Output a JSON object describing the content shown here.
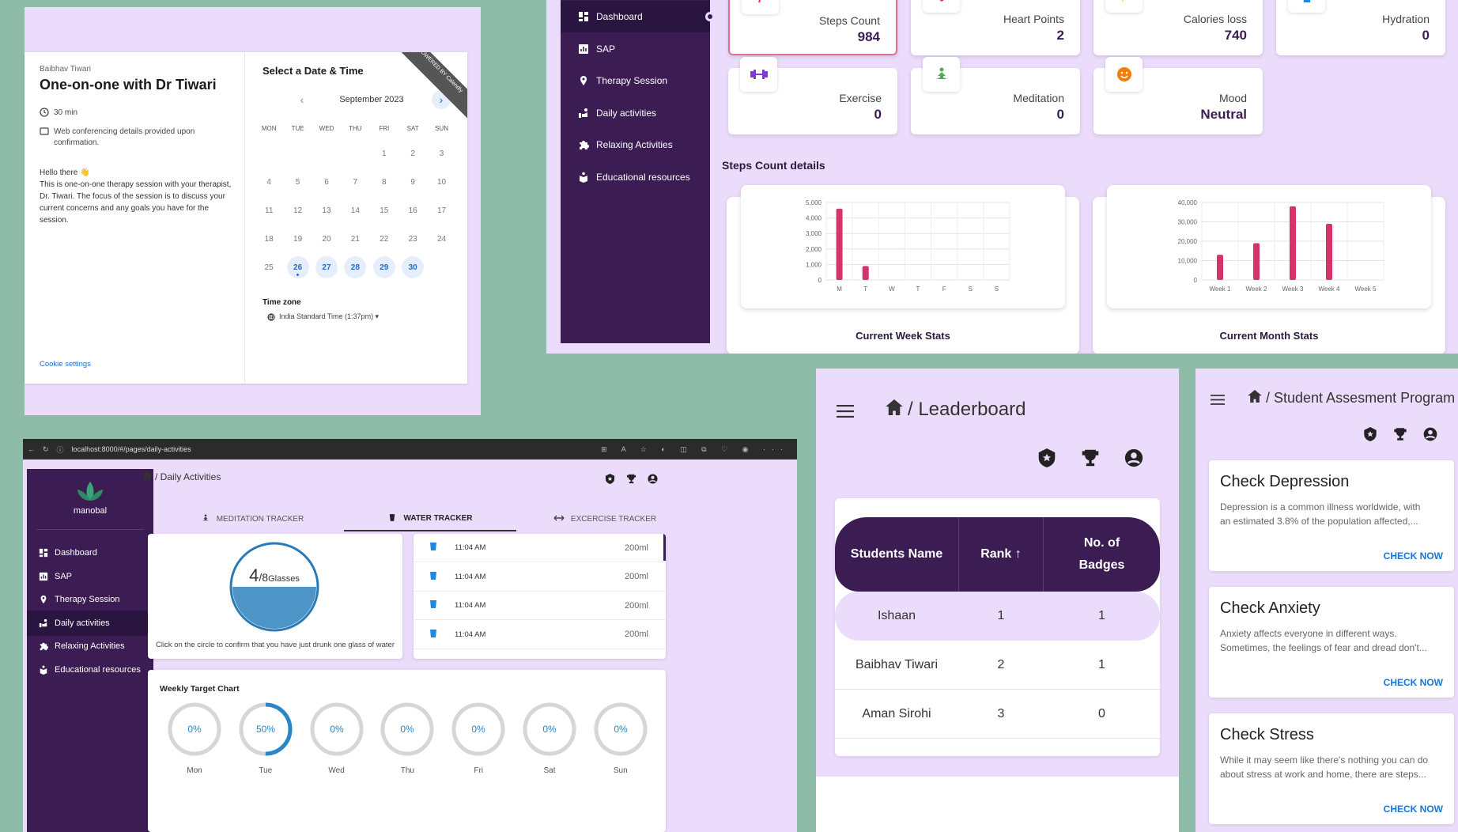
{
  "calendly": {
    "host": "Baibhav Tiwari",
    "title": "One-on-one with Dr Tiwari",
    "duration": "30 min",
    "conferencing": "Web conferencing details provided upon confirmation.",
    "greeting": "Hello there 👋",
    "description": "This is one-on-one therapy session with your therapist, Dr. Tiwari. The focus of the session is to discuss your current concerns and any goals you have for the session.",
    "cookie": "Cookie settings",
    "select_title": "Select a Date & Time",
    "month": "September 2023",
    "weekdays": [
      "MON",
      "TUE",
      "WED",
      "THU",
      "FRI",
      "SAT",
      "SUN"
    ],
    "days": [
      "",
      "",
      "",
      "",
      "1",
      "2",
      "3",
      "4",
      "5",
      "6",
      "7",
      "8",
      "9",
      "10",
      "11",
      "12",
      "13",
      "14",
      "15",
      "16",
      "17",
      "18",
      "19",
      "20",
      "21",
      "22",
      "23",
      "24",
      "25",
      "26",
      "27",
      "28",
      "29",
      "30",
      ""
    ],
    "available": [
      "26",
      "27",
      "28",
      "29",
      "30"
    ],
    "today": "26",
    "tz_label": "Time zone",
    "tz_value": "India Standard Time (1:37pm) ▾",
    "ribbon": "POWERED BY Calendly"
  },
  "dashboard": {
    "nav": [
      {
        "label": "Dashboard",
        "icon": "dashboard-icon"
      },
      {
        "label": "SAP",
        "icon": "chart-icon"
      },
      {
        "label": "Therapy Session",
        "icon": "location-icon"
      },
      {
        "label": "Daily activities",
        "icon": "activity-icon"
      },
      {
        "label": "Relaxing Activities",
        "icon": "puzzle-icon"
      },
      {
        "label": "Educational resources",
        "icon": "education-icon"
      }
    ],
    "stats": [
      {
        "label": "Steps Count",
        "value": "984",
        "icon": "walk-icon",
        "color": "#e4276a"
      },
      {
        "label": "Heart Points",
        "value": "2",
        "icon": "heart-icon",
        "color": "#e4276a"
      },
      {
        "label": "Calories loss",
        "value": "740",
        "icon": "bolt-icon",
        "color": "#f2c12e"
      },
      {
        "label": "Hydration",
        "value": "0",
        "icon": "cup-icon",
        "color": "#1e88e5"
      },
      {
        "label": "Exercise",
        "value": "0",
        "icon": "dumbbell-icon",
        "color": "#7b3fd1"
      },
      {
        "label": "Meditation",
        "value": "0",
        "icon": "meditation-icon",
        "color": "#4caf50"
      },
      {
        "label": "Mood",
        "value": "Neutral",
        "icon": "smile-icon",
        "color": "#f57c00"
      }
    ],
    "steps_title": "Steps Count details",
    "week_caption": "Current Week Stats",
    "month_caption": "Current Month Stats"
  },
  "chart_data": [
    {
      "type": "bar",
      "categories": [
        "M",
        "T",
        "W",
        "T",
        "F",
        "S",
        "S"
      ],
      "values": [
        4600,
        900,
        0,
        0,
        0,
        0,
        0
      ],
      "title": "Current Week Stats",
      "yticks": [
        "0",
        "1,000",
        "2,000",
        "3,000",
        "4,000",
        "5,000"
      ],
      "ylim": [
        0,
        5000
      ],
      "grid": true,
      "color": "#d6336c"
    },
    {
      "type": "bar",
      "categories": [
        "Week 1",
        "Week 2",
        "Week 3",
        "Week 4",
        "Week 5"
      ],
      "values": [
        13000,
        19000,
        38000,
        29000,
        0
      ],
      "title": "Current Month Stats",
      "yticks": [
        "0",
        "10,000",
        "20,000",
        "30,000",
        "40,000"
      ],
      "ylim": [
        0,
        40000
      ],
      "grid": true,
      "color": "#d6336c"
    }
  ],
  "daily": {
    "url": "localhost:8000/#/pages/daily-activities",
    "logo": "manobal",
    "breadcrumb": "/ Daily Activities",
    "tabs": [
      "MEDITATION TRACKER",
      "WATER TRACKER",
      "EXCERCISE TRACKER"
    ],
    "active_tab": 1,
    "glasses_count": "4",
    "glasses_total": "/8",
    "glasses_unit": "Glasses",
    "water_fill": 0.5,
    "water_hint": "Click on the circle to confirm that you have just drunk one glass of water",
    "log": [
      {
        "time": "11:04 AM",
        "amount": "200ml"
      },
      {
        "time": "11:04 AM",
        "amount": "200ml"
      },
      {
        "time": "11:04 AM",
        "amount": "200ml"
      },
      {
        "time": "11:04 AM",
        "amount": "200ml"
      }
    ],
    "weekly_title": "Weekly Target Chart",
    "weekly": [
      {
        "day": "Mon",
        "pct": "0%",
        "value": 0
      },
      {
        "day": "Tue",
        "pct": "50%",
        "value": 0.5
      },
      {
        "day": "Wed",
        "pct": "0%",
        "value": 0
      },
      {
        "day": "Thu",
        "pct": "0%",
        "value": 0
      },
      {
        "day": "Fri",
        "pct": "0%",
        "value": 0
      },
      {
        "day": "Sat",
        "pct": "0%",
        "value": 0
      },
      {
        "day": "Sun",
        "pct": "0%",
        "value": 0
      }
    ]
  },
  "leaderboard": {
    "title": "/ Leaderboard",
    "headers": [
      "Students Name",
      "Rank ↑",
      "No. of Badges"
    ],
    "rows": [
      {
        "name": "Ishaan",
        "rank": "1",
        "badges": "1"
      },
      {
        "name": "Baibhav Tiwari",
        "rank": "2",
        "badges": "1"
      },
      {
        "name": "Aman Sirohi",
        "rank": "3",
        "badges": "0"
      }
    ]
  },
  "assessment": {
    "title": "/ Student Assesment Program",
    "cards": [
      {
        "title": "Check Depression",
        "line1": "Depression is a common illness worldwide, with",
        "line2": "an estimated 3.8% of the population affected,...",
        "button": "CHECK NOW"
      },
      {
        "title": "Check Anxiety",
        "line1": "Anxiety affects everyone in different ways.",
        "line2": "Sometimes, the feelings of fear and dread don't...",
        "button": "CHECK NOW"
      },
      {
        "title": "Check Stress",
        "line1": "While it may seem like there's nothing you can do",
        "line2": "about stress at work and home, there are steps...",
        "button": "CHECK NOW"
      }
    ]
  }
}
